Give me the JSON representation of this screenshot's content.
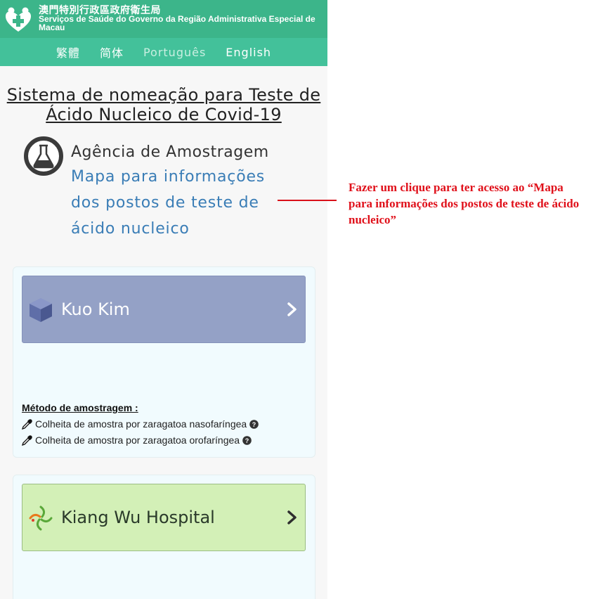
{
  "header": {
    "org_name_zh": "澳門特別行政區政府衛生局",
    "org_name_pt": "Serviços de Saúde do Governo da Região Administrativa Especial de Macau"
  },
  "languages": [
    {
      "label": "繁體",
      "active": false
    },
    {
      "label": "简体",
      "active": false
    },
    {
      "label": "Português",
      "active": true
    },
    {
      "label": "English",
      "active": false
    }
  ],
  "page": {
    "title": "Sistema de nomeação para Teste de Ácido Nucleico de Covid-19",
    "agency_label": "Agência de Amostragem",
    "map_link": "Mapa para informações dos postos de teste de ácido nucleico"
  },
  "sites": [
    {
      "name": "Kuo Kim",
      "icon": "cube-icon",
      "color": "#94a1c6",
      "methods_title": "Método de amostragem :",
      "methods": [
        "Colheita de amostra por zaragatoa nasofaríngea",
        "Colheita de amostra por zaragatoa orofaríngea"
      ]
    },
    {
      "name": "Kiang Wu Hospital",
      "icon": "kiang-wu-logo-icon",
      "color": "#d3f0b7"
    }
  ],
  "annotation": {
    "text": "Fazer um clique para ter acesso ao “Mapa para informações dos postos de teste de ácido nucleico”",
    "color": "#e0101a"
  },
  "colors": {
    "header": "#3cb58a",
    "langbar": "#43c19a",
    "link": "#3a7db6"
  }
}
